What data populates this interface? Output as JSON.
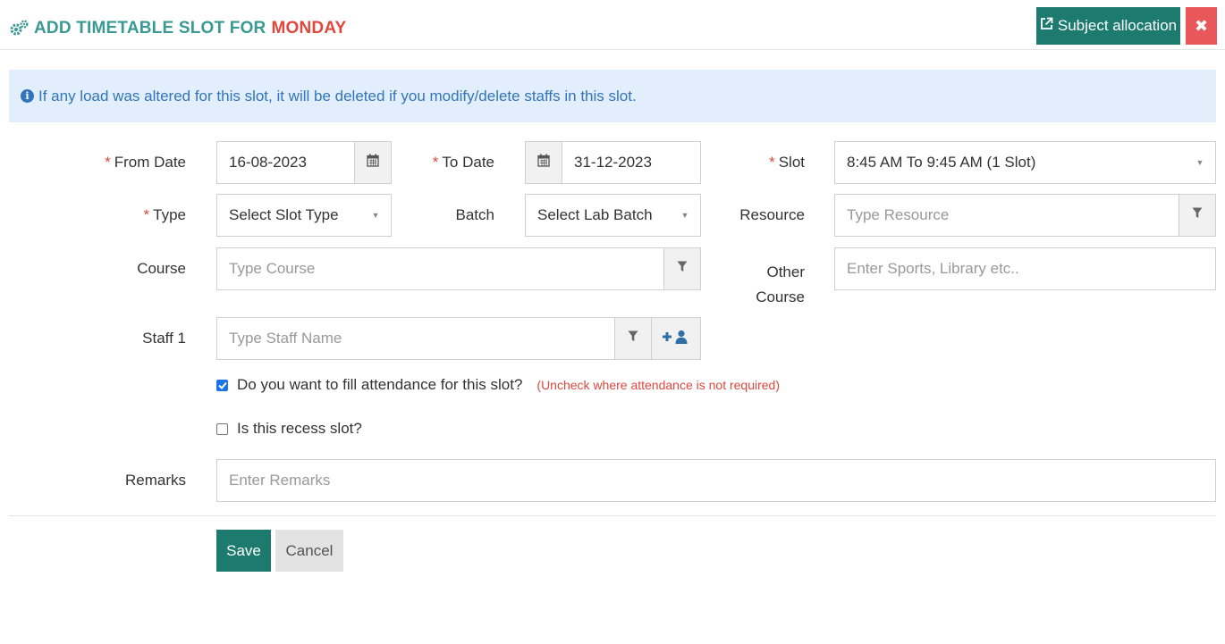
{
  "header": {
    "title_prefix": "ADD TIMETABLE SLOT FOR",
    "title_day": "MONDAY",
    "subject_allocation_label": "Subject allocation",
    "close_label": "✖"
  },
  "info_banner": {
    "icon": "info-icon",
    "text": "If any load was altered for this slot, it will be deleted if you modify/delete staffs in this slot."
  },
  "form": {
    "from_date": {
      "label": "From Date",
      "required": true,
      "value": "16-08-2023",
      "icon": "calendar-icon"
    },
    "to_date": {
      "label": "To Date",
      "required": true,
      "value": "31-12-2023",
      "icon": "calendar-icon"
    },
    "slot": {
      "label": "Slot",
      "required": true,
      "value": "8:45 AM To 9:45 AM (1 Slot)"
    },
    "type": {
      "label": "Type",
      "required": true,
      "placeholder": "Select Slot Type"
    },
    "batch": {
      "label": "Batch",
      "placeholder": "Select Lab Batch"
    },
    "resource": {
      "label": "Resource",
      "placeholder": "Type Resource",
      "icon": "filter-icon"
    },
    "course": {
      "label": "Course",
      "placeholder": "Type Course",
      "icon": "filter-icon"
    },
    "other_course": {
      "label_line1": "Other",
      "label_line2": "Course",
      "placeholder": "Enter Sports, Library etc.."
    },
    "staff1": {
      "label": "Staff 1",
      "placeholder": "Type Staff Name",
      "icons": [
        "filter-icon",
        "add-user-icon"
      ]
    },
    "attendance": {
      "label": "Do you want to fill attendance for this slot?",
      "checked": true,
      "note": "(Uncheck where attendance is not required)"
    },
    "recess": {
      "label": "Is this recess slot?",
      "checked": false
    },
    "remarks": {
      "label": "Remarks",
      "placeholder": "Enter Remarks"
    }
  },
  "actions": {
    "save_label": "Save",
    "cancel_label": "Cancel"
  },
  "colors": {
    "primary": "#1c7a6f",
    "title_teal": "#3a9a93",
    "danger": "#e9575a",
    "required_red": "#e0473d",
    "info_bg": "#e2eefb",
    "info_text": "#3275b8"
  }
}
